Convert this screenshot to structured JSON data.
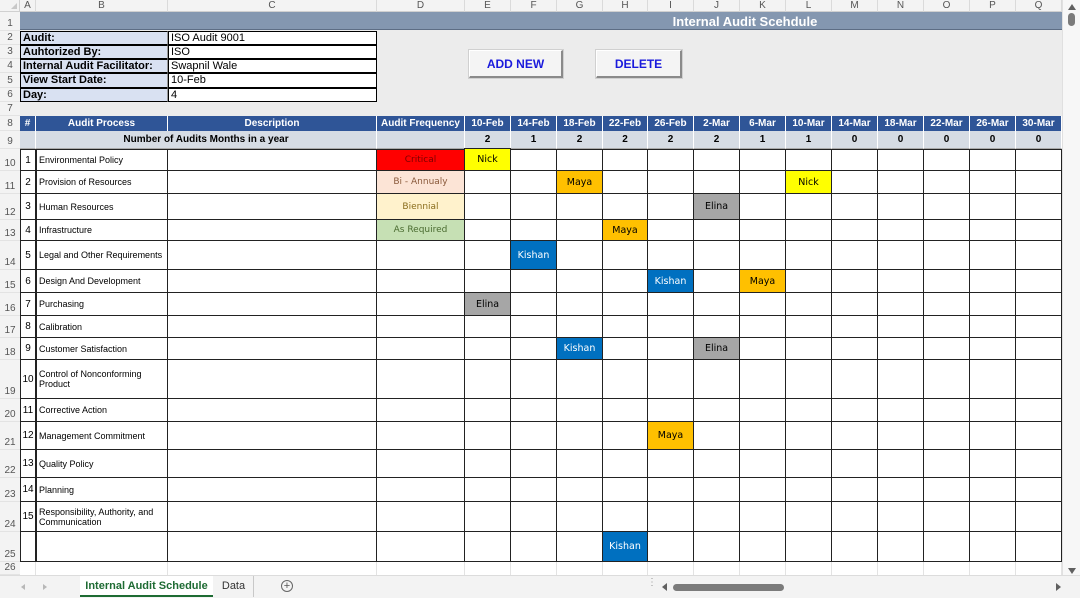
{
  "spreadsheet": {
    "column_letters": [
      "A",
      "B",
      "C",
      "D",
      "E",
      "F",
      "G",
      "H",
      "I",
      "J",
      "K",
      "L",
      "M",
      "N",
      "O",
      "P",
      "Q"
    ],
    "row_numbers": [
      "1",
      "2",
      "3",
      "4",
      "5",
      "6",
      "7",
      "8",
      "9",
      "10",
      "11",
      "12",
      "13",
      "14",
      "15",
      "16",
      "17",
      "18",
      "19",
      "20",
      "21",
      "22",
      "23",
      "24",
      "25",
      "26"
    ]
  },
  "title": "Internal Audit Scehdule",
  "info": [
    {
      "label": "Audit:",
      "value": "ISO Audit 9001"
    },
    {
      "label": "Auhtorized By:",
      "value": "ISO"
    },
    {
      "label": "Internal Audit Facilitator:",
      "value": "Swapnil Wale"
    },
    {
      "label": "View Start Date:",
      "value": "10-Feb"
    },
    {
      "label": "Day:",
      "value": "4"
    }
  ],
  "buttons": {
    "add_new": "ADD NEW",
    "delete": "DELETE"
  },
  "table": {
    "headers": {
      "num": "#",
      "process": "Audit Process",
      "description": "Description",
      "frequency": "Audit Frequency"
    },
    "summary_label": "Number of Audits Months in a year",
    "dates": [
      "10-Feb",
      "14-Feb",
      "18-Feb",
      "22-Feb",
      "26-Feb",
      "2-Mar",
      "6-Mar",
      "10-Mar",
      "14-Mar",
      "18-Mar",
      "22-Mar",
      "26-Mar",
      "30-Mar"
    ],
    "counts": [
      "2",
      "1",
      "2",
      "2",
      "2",
      "2",
      "1",
      "1",
      "0",
      "0",
      "0",
      "0",
      "0"
    ],
    "rows": [
      {
        "num": "1",
        "process": "Environmental Policy",
        "frequency": "Critical"
      },
      {
        "num": "2",
        "process": "Provision of Resources",
        "frequency": "Bi - Annualy"
      },
      {
        "num": "3",
        "process": "Human Resources",
        "frequency": "Biennial"
      },
      {
        "num": "4",
        "process": "Infrastructure",
        "frequency": "As Required"
      },
      {
        "num": "5",
        "process": "Legal and Other Requirements",
        "frequency": ""
      },
      {
        "num": "6",
        "process": "Design And Development",
        "frequency": ""
      },
      {
        "num": "7",
        "process": "Purchasing",
        "frequency": ""
      },
      {
        "num": "8",
        "process": "Calibration",
        "frequency": ""
      },
      {
        "num": "9",
        "process": "Customer Satisfaction",
        "frequency": ""
      },
      {
        "num": "10",
        "process": "Control of Nonconforming Product",
        "frequency": ""
      },
      {
        "num": "11",
        "process": "Corrective Action",
        "frequency": ""
      },
      {
        "num": "12",
        "process": "Management Commitment",
        "frequency": ""
      },
      {
        "num": "13",
        "process": "Quality Policy",
        "frequency": ""
      },
      {
        "num": "14",
        "process": "Planning",
        "frequency": ""
      },
      {
        "num": "15",
        "process": "Responsibility, Authority, and Communication",
        "frequency": ""
      },
      {
        "num": "",
        "process": "",
        "frequency": ""
      }
    ],
    "frequency_colors": {
      "Critical": {
        "bg": "#ff0000",
        "fg": "#7a0000"
      },
      "Bi - Annualy": {
        "bg": "#fce4d6",
        "fg": "#8a5a3c"
      },
      "Biennial": {
        "bg": "#fff2cc",
        "fg": "#8a6d1c"
      },
      "As Required": {
        "bg": "#c6e0b4",
        "fg": "#4a6b30"
      }
    },
    "auditor_colors": {
      "Nick": {
        "bg": "#ffff00",
        "fg": "#000000"
      },
      "Maya": {
        "bg": "#ffc000",
        "fg": "#000000"
      },
      "Elina": {
        "bg": "#a6a6a6",
        "fg": "#000000"
      },
      "Kishan": {
        "bg": "#0070c0",
        "fg": "#ffffff"
      }
    },
    "assignments": [
      {
        "row": 0,
        "date": "10-Feb",
        "auditor": "Nick"
      },
      {
        "row": 1,
        "date": "18-Feb",
        "auditor": "Maya"
      },
      {
        "row": 1,
        "date": "10-Mar",
        "auditor": "Nick"
      },
      {
        "row": 2,
        "date": "2-Mar",
        "auditor": "Elina"
      },
      {
        "row": 3,
        "date": "22-Feb",
        "auditor": "Maya"
      },
      {
        "row": 4,
        "date": "14-Feb",
        "auditor": "Kishan"
      },
      {
        "row": 5,
        "date": "26-Feb",
        "auditor": "Kishan"
      },
      {
        "row": 5,
        "date": "6-Mar",
        "auditor": "Maya"
      },
      {
        "row": 6,
        "date": "10-Feb",
        "auditor": "Elina"
      },
      {
        "row": 8,
        "date": "18-Feb",
        "auditor": "Kishan"
      },
      {
        "row": 8,
        "date": "2-Mar",
        "auditor": "Elina"
      },
      {
        "row": 11,
        "date": "26-Feb",
        "auditor": "Maya"
      },
      {
        "row": 15,
        "date": "22-Feb",
        "auditor": "Kishan"
      }
    ]
  },
  "sheet_tabs": {
    "active": "Internal Audit Schedule",
    "other": "Data",
    "add_label": "+"
  }
}
